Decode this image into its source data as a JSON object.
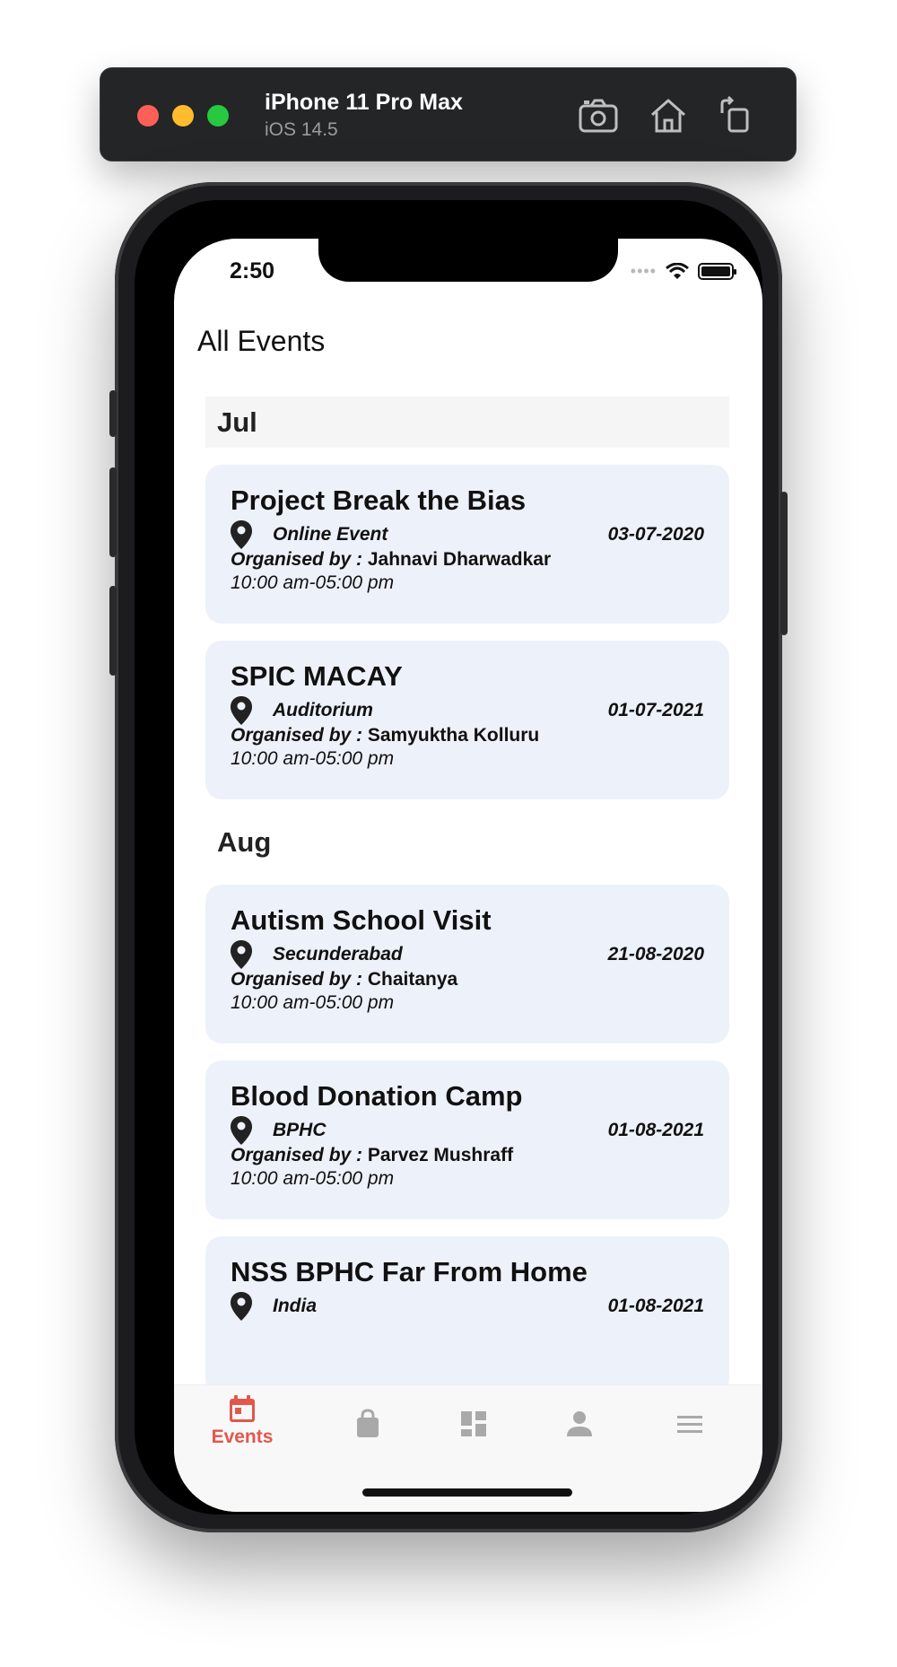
{
  "simulator": {
    "device_name": "iPhone 11 Pro Max",
    "os_version": "iOS 14.5",
    "toolbar_icons": [
      "screenshot-icon",
      "home-icon",
      "rotate-icon"
    ]
  },
  "status_bar": {
    "time": "2:50",
    "icons": [
      "signal-icon",
      "wifi-icon",
      "battery-icon"
    ]
  },
  "header": {
    "title": "All Events"
  },
  "sections": [
    {
      "month": "Jul",
      "events": [
        {
          "title": "Project Break the Bias",
          "location": "Online Event",
          "date": "03-07-2020",
          "organised_label": "Organised by :",
          "organiser": "Jahnavi Dharwadkar",
          "time": "10:00 am-05:00 pm"
        },
        {
          "title": "SPIC MACAY",
          "location": "Auditorium",
          "date": "01-07-2021",
          "organised_label": "Organised by :",
          "organiser": "Samyuktha Kolluru",
          "time": "10:00 am-05:00 pm"
        }
      ]
    },
    {
      "month": "Aug",
      "events": [
        {
          "title": "Autism School Visit",
          "location": "Secunderabad",
          "date": "21-08-2020",
          "organised_label": "Organised by :",
          "organiser": "Chaitanya",
          "time": "10:00 am-05:00 pm"
        },
        {
          "title": "Blood Donation Camp",
          "location": "BPHC",
          "date": "01-08-2021",
          "organised_label": "Organised by :",
          "organiser": "Parvez Mushraff",
          "time": "10:00 am-05:00 pm"
        },
        {
          "title": "NSS BPHC Far From Home",
          "location": "India",
          "date": "01-08-2021"
        }
      ]
    }
  ],
  "tabbar": {
    "active_label": "Events",
    "active_color": "#e2574c",
    "inactive_color": "#a9a9a9",
    "tabs": [
      "calendar-icon",
      "shopping-bag-icon",
      "dashboard-icon",
      "person-icon",
      "menu-icon"
    ]
  }
}
